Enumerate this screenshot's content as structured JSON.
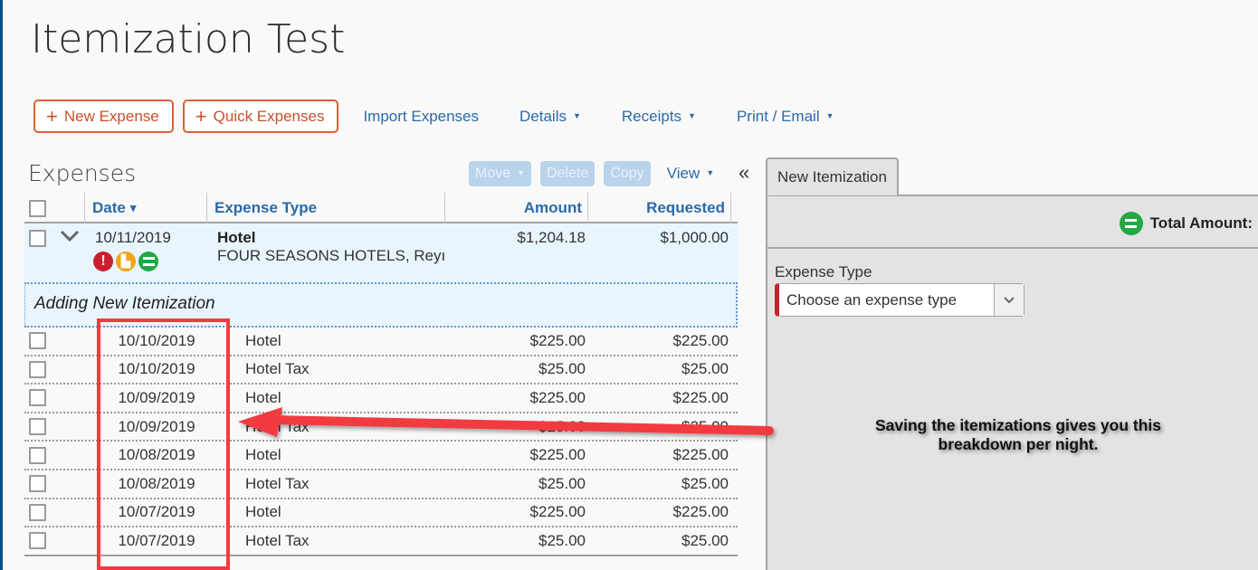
{
  "page": {
    "title": "Itemization Test"
  },
  "toolbar": {
    "new_expense": "New Expense",
    "quick_expenses": "Quick Expenses",
    "import_expenses": "Import Expenses",
    "details": "Details",
    "receipts": "Receipts",
    "print_email": "Print / Email",
    "plus_glyph": "+",
    "caret_glyph": "▼"
  },
  "expenses": {
    "title": "Expenses",
    "actions": {
      "move": "Move",
      "delete": "Delete",
      "copy": "Copy",
      "view": "View",
      "collapse_glyph": "«"
    },
    "columns": {
      "date": "Date",
      "date_sort": "▾",
      "expense_type": "Expense Type",
      "amount": "Amount",
      "requested": "Requested"
    },
    "parent": {
      "date": "10/11/2019",
      "type": "Hotel",
      "vendor": "FOUR SEASONS HOTELS, Reyı",
      "amount": "$1,204.18",
      "requested": "$1,000.00",
      "status_icons": [
        {
          "name": "exception-icon",
          "glyph": "!",
          "color": "#c9202e"
        },
        {
          "name": "receipt-icon",
          "glyph": "▙",
          "color": "#f2a516"
        },
        {
          "name": "itemized-equal-icon",
          "glyph": "=",
          "color": "#22a845"
        }
      ]
    },
    "adding_label": "Adding New Itemization",
    "items": [
      {
        "date": "10/10/2019",
        "type": "Hotel",
        "amount": "$225.00",
        "requested": "$225.00"
      },
      {
        "date": "10/10/2019",
        "type": "Hotel Tax",
        "amount": "$25.00",
        "requested": "$25.00"
      },
      {
        "date": "10/09/2019",
        "type": "Hotel",
        "amount": "$225.00",
        "requested": "$225.00"
      },
      {
        "date": "10/09/2019",
        "type": "Hotel Tax",
        "amount": "$25.00",
        "requested": "$25.00"
      },
      {
        "date": "10/08/2019",
        "type": "Hotel",
        "amount": "$225.00",
        "requested": "$225.00"
      },
      {
        "date": "10/08/2019",
        "type": "Hotel Tax",
        "amount": "$25.00",
        "requested": "$25.00"
      },
      {
        "date": "10/07/2019",
        "type": "Hotel",
        "amount": "$225.00",
        "requested": "$225.00"
      },
      {
        "date": "10/07/2019",
        "type": "Hotel Tax",
        "amount": "$25.00",
        "requested": "$25.00"
      }
    ]
  },
  "itemization_panel": {
    "tab_label": "New Itemization",
    "total_amount_label": "Total Amount:",
    "expense_type_label": "Expense Type",
    "expense_type_placeholder": "Choose an expense type"
  },
  "annotation": {
    "line1": "Saving the itemizations gives you this",
    "line2": "breakdown per night."
  },
  "colors": {
    "accent_orange": "#d9603b",
    "link_blue": "#2a6aa9",
    "annotation_red": "#f23b40",
    "required_red": "#c9202e",
    "ok_green": "#22a845"
  }
}
